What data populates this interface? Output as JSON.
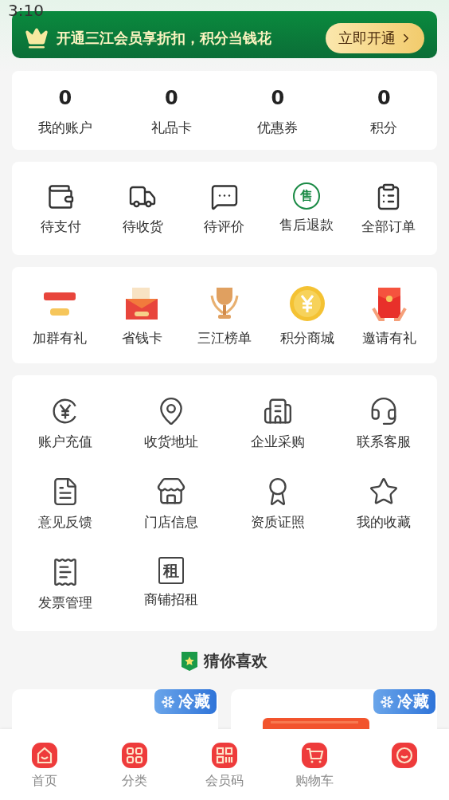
{
  "status_bar": {
    "time": "3:10"
  },
  "vip_banner": {
    "text": "开通三江会员享折扣，积分当钱花",
    "button": "立即开通"
  },
  "stats": [
    {
      "value": "0",
      "label": "我的账户"
    },
    {
      "value": "0",
      "label": "礼品卡"
    },
    {
      "value": "0",
      "label": "优惠券"
    },
    {
      "value": "0",
      "label": "积分"
    }
  ],
  "orders": [
    {
      "kind": "wallet",
      "label": "待支付"
    },
    {
      "kind": "truck",
      "label": "待收货"
    },
    {
      "kind": "chat",
      "label": "待评价"
    },
    {
      "kind": "after_sale",
      "label": "售后退款",
      "glyph": "售"
    },
    {
      "kind": "list",
      "label": "全部订单"
    }
  ],
  "promos": [
    {
      "kind": "lottery",
      "label": "加群有礼"
    },
    {
      "kind": "envelope",
      "label": "省钱卡"
    },
    {
      "kind": "trophy",
      "label": "三江榜单"
    },
    {
      "kind": "coin",
      "label": "积分商城"
    },
    {
      "kind": "redpacket",
      "label": "邀请有礼"
    }
  ],
  "services": [
    {
      "kind": "yen",
      "label": "账户充值"
    },
    {
      "kind": "pin",
      "label": "收货地址"
    },
    {
      "kind": "building",
      "label": "企业采购"
    },
    {
      "kind": "headset",
      "label": "联系客服"
    },
    {
      "kind": "doc",
      "label": "意见反馈"
    },
    {
      "kind": "store",
      "label": "门店信息"
    },
    {
      "kind": "award",
      "label": "资质证照"
    },
    {
      "kind": "star",
      "label": "我的收藏"
    },
    {
      "kind": "receipt",
      "label": "发票管理"
    },
    {
      "kind": "rent",
      "label": "商铺招租",
      "glyph": "租"
    }
  ],
  "recommend": {
    "title": "猜你喜欢",
    "products": [
      {
        "badge": "冷藏",
        "kind": "blank"
      },
      {
        "badge": "冷藏",
        "kind": "picture"
      }
    ]
  },
  "tab_bar": [
    {
      "kind": "home",
      "label": "首页"
    },
    {
      "kind": "grid",
      "label": "分类"
    },
    {
      "kind": "qr",
      "label": "会员码"
    },
    {
      "kind": "cart",
      "label": "购物车"
    },
    {
      "kind": "face"
    }
  ]
}
